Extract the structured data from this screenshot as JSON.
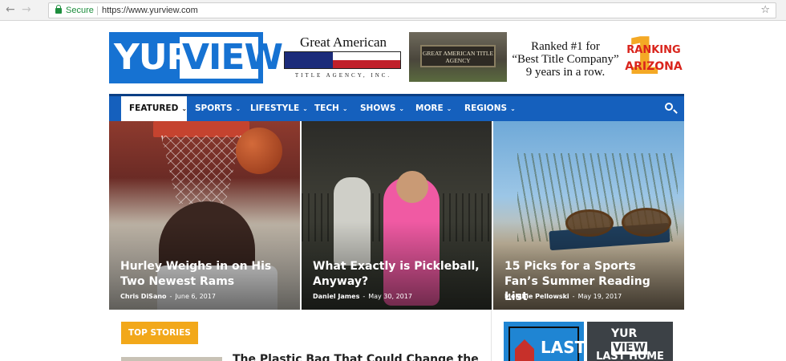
{
  "browser": {
    "back_arrow": "←",
    "forward_arrow": "→",
    "secure_label": "Secure",
    "url": "https://www.yurview.com",
    "bookmark_star": "☆"
  },
  "header": {
    "logo": {
      "part1": "YUR",
      "part2": "VIEW",
      "brand_color": "#1672d2"
    },
    "ads": {
      "great_american_logo": {
        "title": "Great American",
        "subtitle": "TITLE AGENCY, INC."
      },
      "sign_photo": {
        "sign_text": "GREAT AMERICAN TITLE AGENCY"
      },
      "ranking": {
        "line1": "Ranked #1 for",
        "line2": "“Best Title Company”",
        "line3": "9 years in a row.",
        "badge_number": "1",
        "badge_word1": "RANKING",
        "badge_word2": "ARIZONA"
      }
    }
  },
  "nav": {
    "items": [
      {
        "label": "FEATURED",
        "active": true
      },
      {
        "label": "SPORTS"
      },
      {
        "label": "LIFESTYLE"
      },
      {
        "label": "TECH"
      },
      {
        "label": "SHOWS"
      },
      {
        "label": "MORE"
      },
      {
        "label": "REGIONS"
      }
    ],
    "chevron": "⌄",
    "bar_color": "#1560bd"
  },
  "featured": [
    {
      "title": "Hurley Weighs in on His Two Newest Rams",
      "author": "Chris DiSano",
      "sep": "-",
      "date": "June 6, 2017"
    },
    {
      "title": "What Exactly is Pickleball, Anyway?",
      "author": "Daniel James",
      "sep": "-",
      "date": "May 30, 2017"
    },
    {
      "title": "15 Picks for a Sports Fan’s Summer Reading List",
      "author": "Melanie Pellowski",
      "sep": "-",
      "date": "May 19, 2017"
    }
  ],
  "top_stories": {
    "label": "TOP STORIES",
    "label_color": "#f2a81a",
    "first_story_title": "The Plastic Bag That Could Change the"
  },
  "sidebar_promos": [
    {
      "text": "LAST"
    },
    {
      "logo_part1": "YUR",
      "logo_part2": "VIEW",
      "text": "LAST HOME"
    }
  ]
}
